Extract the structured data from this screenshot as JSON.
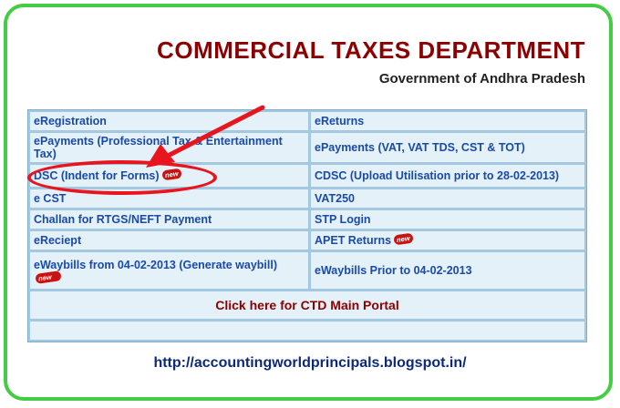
{
  "header": {
    "title": "COMMERCIAL TAXES DEPARTMENT",
    "subtitle": "Government of Andhra Pradesh"
  },
  "links": {
    "rows": [
      {
        "left": "eRegistration",
        "right": "eReturns"
      },
      {
        "left": "ePayments (Professional Tax & Entertainment Tax)",
        "right": "ePayments (VAT, VAT TDS, CST & TOT)"
      },
      {
        "left": "DSC (Indent for Forms)",
        "right": "CDSC (Upload Utilisation prior to 28-02-2013)"
      },
      {
        "left": "e CST",
        "right": "VAT250"
      },
      {
        "left": "Challan for RTGS/NEFT Payment",
        "right": "STP Login"
      },
      {
        "left": "eReciept",
        "right": "APET Returns"
      },
      {
        "left": "eWaybills from 04-02-2013 (Generate waybill)",
        "right": "eWaybills Prior to 04-02-2013"
      }
    ],
    "new_badge": "new",
    "portal_link": "Click here for CTD Main Portal"
  },
  "footer": {
    "url": "http://accountingworldprincipals.blogspot.in/"
  },
  "colors": {
    "frame_border": "#44cc44",
    "title": "#8b0000",
    "link": "#1a4aa8",
    "highlight": "#e8141e",
    "cell_bg": "#e4f1f9"
  }
}
